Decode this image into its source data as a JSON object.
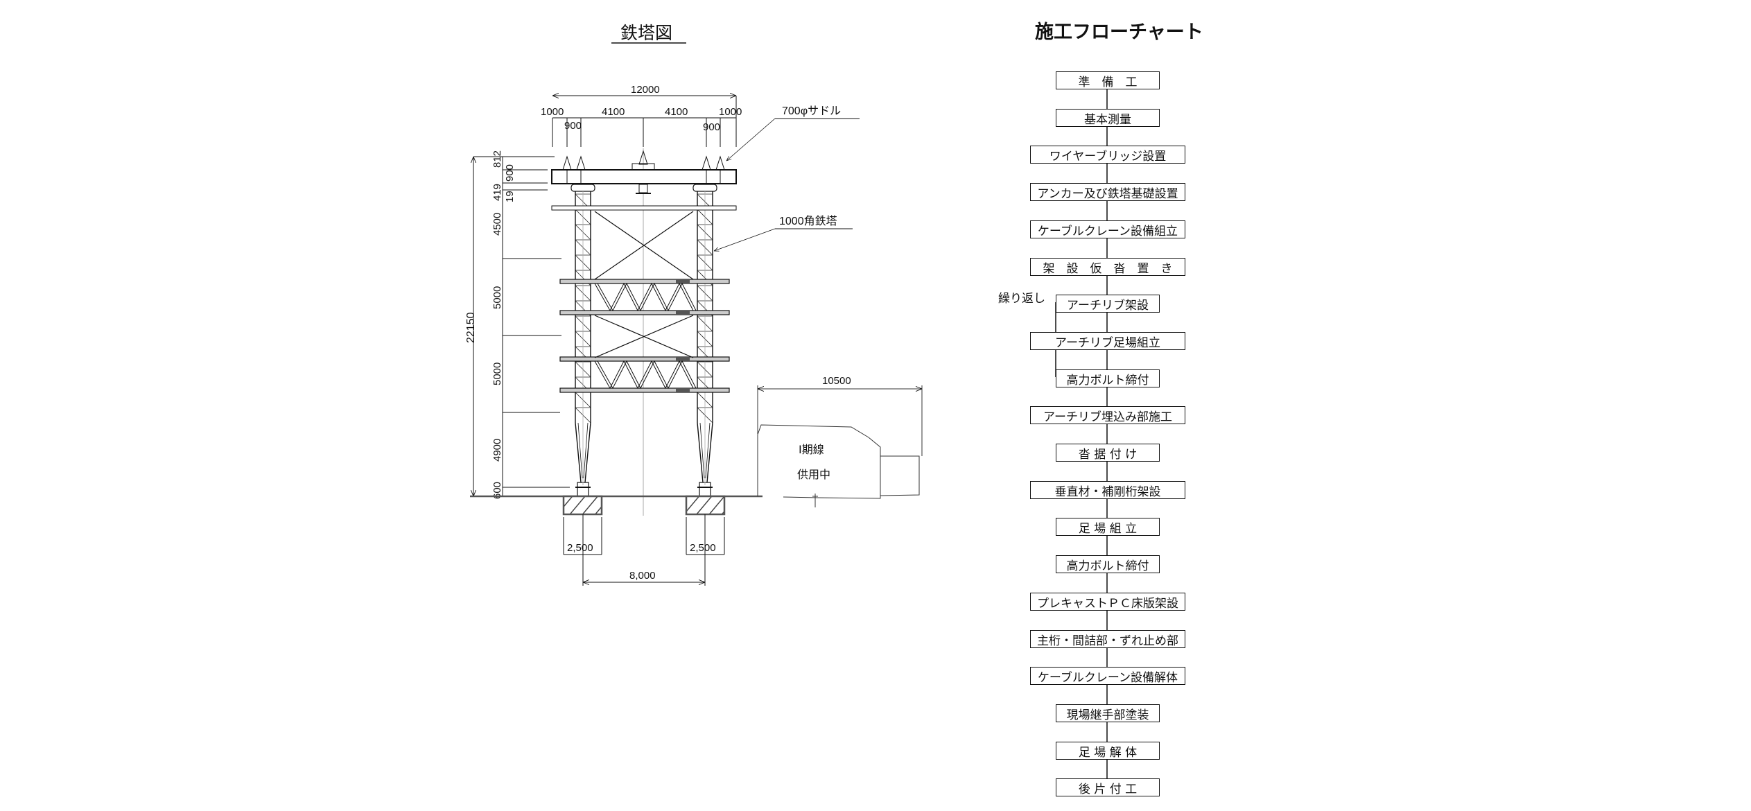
{
  "tower_diagram": {
    "title": "鉄塔図",
    "dims_top": {
      "overall": "12000",
      "segments": [
        "1000",
        "4100",
        "4100",
        "1000"
      ],
      "saddle_spacing_left": "900",
      "saddle_spacing_right": "900"
    },
    "dims_left": {
      "overall": "22150",
      "segments": [
        "812",
        "900",
        "419",
        "19",
        "4500",
        "5000",
        "5000",
        "4900",
        "600"
      ]
    },
    "dims_bottom": {
      "footing_left": "2,500",
      "footing_right": "2,500",
      "leg_spacing": "8,000"
    },
    "callouts": {
      "saddle": "700φサドル",
      "tower": "1000角鉄塔"
    },
    "existing_line": {
      "width_dim": "10500",
      "label_line1": "Ⅰ期線",
      "label_line2": "供用中"
    }
  },
  "flowchart": {
    "title": "施工フローチャート",
    "loop_label": "繰り返し",
    "steps": [
      {
        "label": "準　備　工",
        "wide": false
      },
      {
        "label": "基本測量",
        "wide": false
      },
      {
        "label": "ワイヤーブリッジ設置",
        "wide": true
      },
      {
        "label": "アンカー及び鉄塔基礎設置",
        "wide": true
      },
      {
        "label": "ケーブルクレーン設備組立",
        "wide": true
      },
      {
        "label": "架　設　仮　沓　置　き",
        "wide": true
      },
      {
        "label": "アーチリブ架設",
        "wide": false
      },
      {
        "label": "アーチリブ足場組立",
        "wide": true
      },
      {
        "label": "高力ボルト締付",
        "wide": false
      },
      {
        "label": "アーチリブ埋込み部施工",
        "wide": true
      },
      {
        "label": "沓 据 付 け",
        "wide": false
      },
      {
        "label": "垂直材・補剛桁架設",
        "wide": true
      },
      {
        "label": "足 場 組 立",
        "wide": false
      },
      {
        "label": "高力ボルト締付",
        "wide": false
      },
      {
        "label": "プレキャストＰＣ床版架設",
        "wide": true
      },
      {
        "label": "主桁・間詰部・ずれ止め部",
        "wide": true
      },
      {
        "label": "ケーブルクレーン設備解体",
        "wide": true
      },
      {
        "label": "現場継手部塗装",
        "wide": false
      },
      {
        "label": "足 場 解 体",
        "wide": false
      },
      {
        "label": "後 片 付 工",
        "wide": false
      }
    ]
  }
}
